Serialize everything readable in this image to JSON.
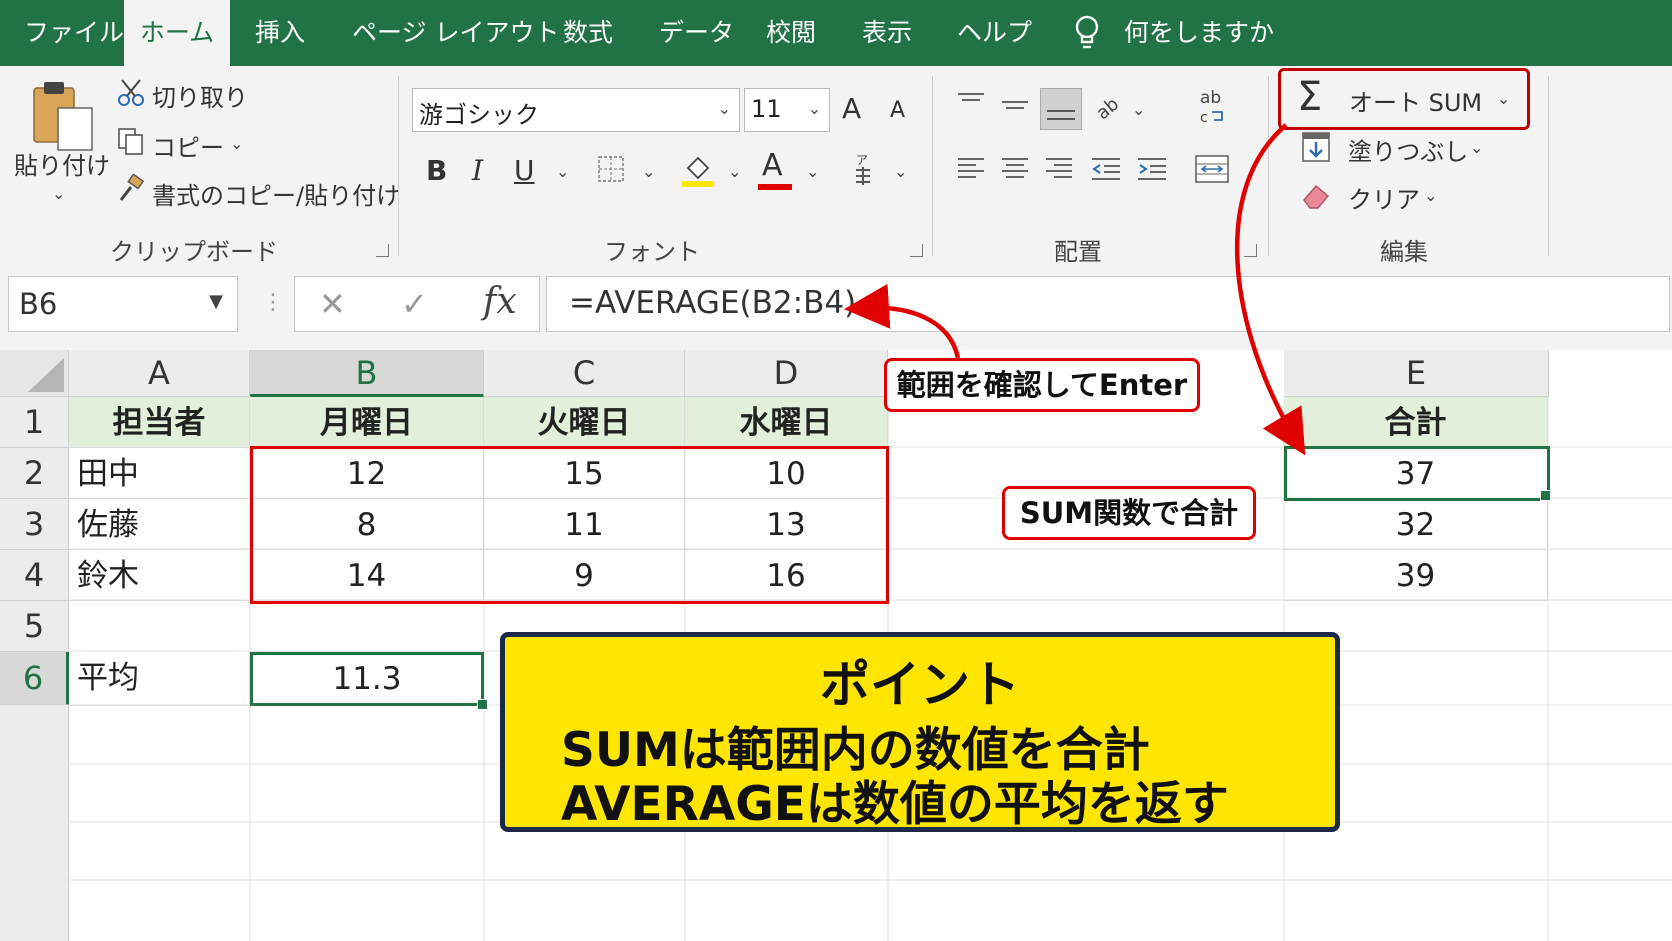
{
  "ribbon_tabs": [
    "ファイル",
    "ホーム",
    "挿入",
    "ページ レイアウト",
    "数式",
    "データ",
    "校閲",
    "表示",
    "ヘルプ"
  ],
  "tell_me": "何をしますか",
  "clipboard": {
    "paste": "貼り付け",
    "cut": "切り取り",
    "copy": "コピー",
    "format_painter": "書式のコピー/貼り付け",
    "group": "クリップボード"
  },
  "font": {
    "name": "游ゴシック",
    "size": "11",
    "bold": "B",
    "italic": "I",
    "underline": "U",
    "font_color": "A",
    "grow": "A",
    "shrink": "A",
    "group": "フォント"
  },
  "alignment": {
    "group": "配置",
    "wrap": "ab"
  },
  "editing": {
    "autosum": "オート SUM",
    "fill": "塗りつぶし",
    "clear": "クリア",
    "group": "編集"
  },
  "formula_bar": {
    "name_box": "B6",
    "cancel": "✕",
    "enter": "✓",
    "fx": "fx",
    "formula": "=AVERAGE(B2:B4)"
  },
  "columns": [
    "A",
    "B",
    "C",
    "D",
    "E"
  ],
  "rows": [
    "1",
    "2",
    "3",
    "4",
    "5",
    "6"
  ],
  "table": {
    "headers": [
      "担当者",
      "月曜日",
      "火曜日",
      "水曜日"
    ],
    "data": [
      [
        "田中",
        "12",
        "15",
        "10"
      ],
      [
        "佐藤",
        "8",
        "11",
        "13"
      ],
      [
        "鈴木",
        "14",
        "9",
        "16"
      ]
    ],
    "avg_label": "平均",
    "avg_value": "11.3",
    "total_header": "合計",
    "totals": [
      "37",
      "32",
      "39"
    ]
  },
  "callouts": {
    "range": "範囲を確認してEnter",
    "sum": "SUM関数で合計"
  },
  "point": {
    "title": "ポイント",
    "line1": "SUMは範囲内の数値を合計",
    "line2": "AVERAGEは数値の平均を返す"
  },
  "colors": {
    "excel_green": "#217346",
    "header_fill": "#e2efda",
    "callout_red": "#e00000",
    "point_yellow": "#ffe600"
  }
}
